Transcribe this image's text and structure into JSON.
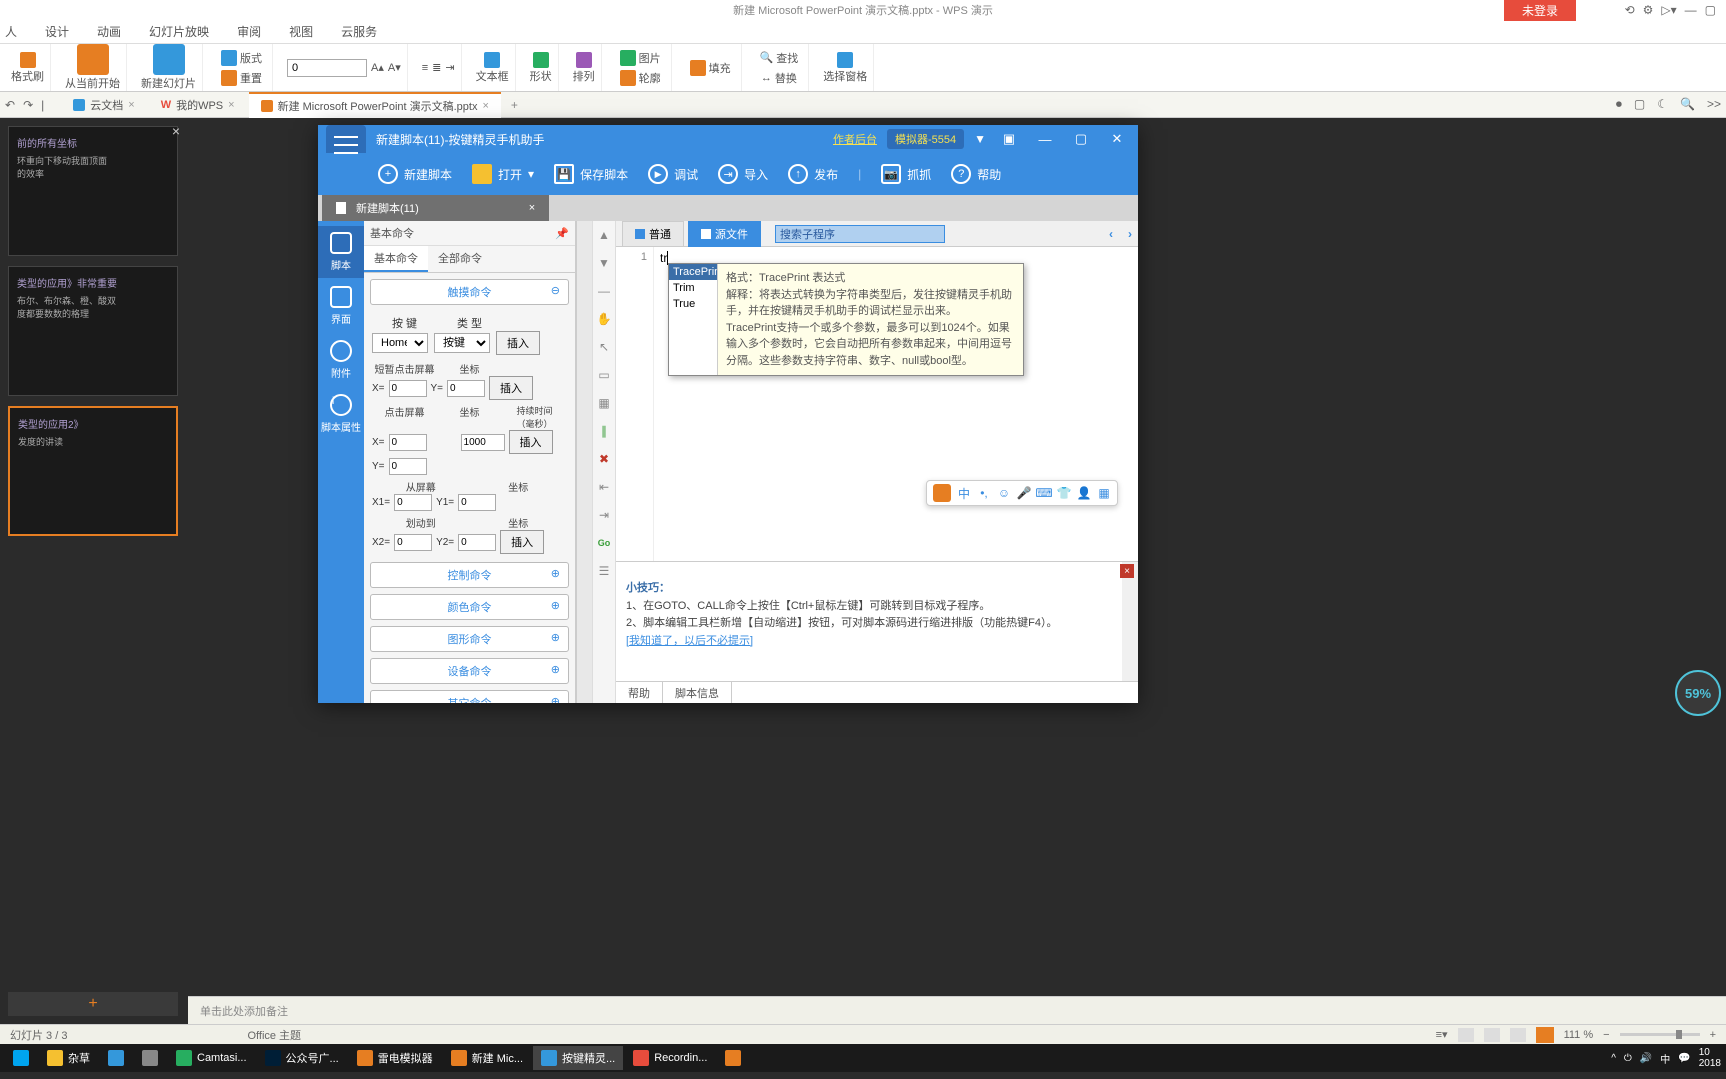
{
  "wps": {
    "title": "新建 Microsoft PowerPoint 演示文稿.pptx - WPS 演示",
    "login": "未登录",
    "menu": [
      "人",
      "设计",
      "动画",
      "幻灯片放映",
      "审阅",
      "视图",
      "云服务"
    ],
    "ribbon": {
      "format_painter": "格式刷",
      "from_start": "从当前开始",
      "new_slide": "新建幻灯片",
      "layout": "版式",
      "reset": "重置",
      "font_size": "0",
      "textbox": "文本框",
      "shape": "形状",
      "arrange": "排列",
      "image": "图片",
      "fill": "填充",
      "outline": "轮廓",
      "find": "查找",
      "replace": "替换",
      "select": "选择窗格"
    },
    "tabs": {
      "cloud": "云文档",
      "mywps": "我的WPS",
      "doc": "新建 Microsoft PowerPoint 演示文稿.pptx"
    },
    "slides": {
      "s1_title": "前的所有坐标",
      "s1_body": "环重向下移动我面顶面\n的效率",
      "s2_title": "类型的应用》非常重要",
      "s2_body": "布尔、布尔森、橙、酸双\n度都要数数的格理",
      "s3_title": "类型的应用2》",
      "s3_body": "发度的讲读"
    },
    "add_slide": "+",
    "notes": "单击此处添加备注",
    "status": {
      "slide": "幻灯片 3 / 3",
      "theme": "Office 主题",
      "zoom": "111 %"
    }
  },
  "script": {
    "title": "新建脚本(11)-按键精灵手机助手",
    "author_link": "作者后台",
    "badge": "模拟器-5554",
    "toolbar": {
      "new": "新建脚本",
      "open": "打开",
      "save": "保存脚本",
      "debug": "调试",
      "import": "导入",
      "publish": "发布",
      "capture": "抓抓",
      "help": "帮助"
    },
    "tab": "新建脚本(11)",
    "leftcol": {
      "script": "脚本",
      "ui": "界面",
      "attach": "附件",
      "props": "脚本属性"
    },
    "cmd": {
      "header": "基本命令",
      "tab_basic": "基本命令",
      "tab_all": "全部命令",
      "touch_section": "触摸命令",
      "key_label": "按 键",
      "type_label": "类 型",
      "key_select": "Home",
      "type_select": "按键",
      "insert": "插入",
      "short_tap": "短暂点击屏幕",
      "coord": "坐标",
      "tap_screen": "点击屏幕",
      "duration": "持续时间\n（毫秒）",
      "duration_val": "1000",
      "from_screen": "从屏幕",
      "drag_to": "划动到",
      "x": "X=",
      "y": "Y=",
      "x1": "X1=",
      "y1": "Y1=",
      "x2": "X2=",
      "y2": "Y2=",
      "zero": "0",
      "sections": {
        "control": "控制命令",
        "color": "颜色命令",
        "shape": "图形命令",
        "device": "设备命令",
        "other": "其它命令"
      }
    },
    "editor": {
      "tab_normal": "普通",
      "tab_source": "源文件",
      "search_placeholder": "搜索子程序",
      "line1": "1",
      "code": "tr",
      "ac": {
        "i1": "TracePrint",
        "i2": "Trim",
        "i3": "True",
        "desc_format": "格式：TracePrint 表达式",
        "desc_explain": "解释：将表达式转换为字符串类型后，发往按键精灵手机助手，并在按键精灵手机助手的调试栏显示出来。",
        "desc_support": "TracePrint支持一个或多个参数，最多可以到1024个。如果输入多个参数时，它会自动把所有参数串起来，中间用逗号分隔。这些参数支持字符串、数字、null或bool型。"
      }
    },
    "bottom": {
      "tip_title": "小技巧：",
      "tip1": "1、在GOTO、CALL命令上按住【Ctrl+鼠标左键】可跳转到目标戏子程序。",
      "tip2": "2、脚本编辑工具栏新增【自动缩进】按钮，可对脚本源码进行缩进排版（功能热键F4）。",
      "dismiss": "[我知道了，以后不必提示]",
      "tab_help": "帮助",
      "tab_info": "脚本信息"
    }
  },
  "taskbar": {
    "items": [
      "杂草",
      "",
      "",
      "Camtasi...",
      "公众号广...",
      "雷电模拟器",
      "新建 Mic...",
      "按键精灵...",
      "Recordin..."
    ],
    "tray": [
      "10",
      "2018"
    ]
  },
  "overlay": {
    "pct": "59%"
  }
}
